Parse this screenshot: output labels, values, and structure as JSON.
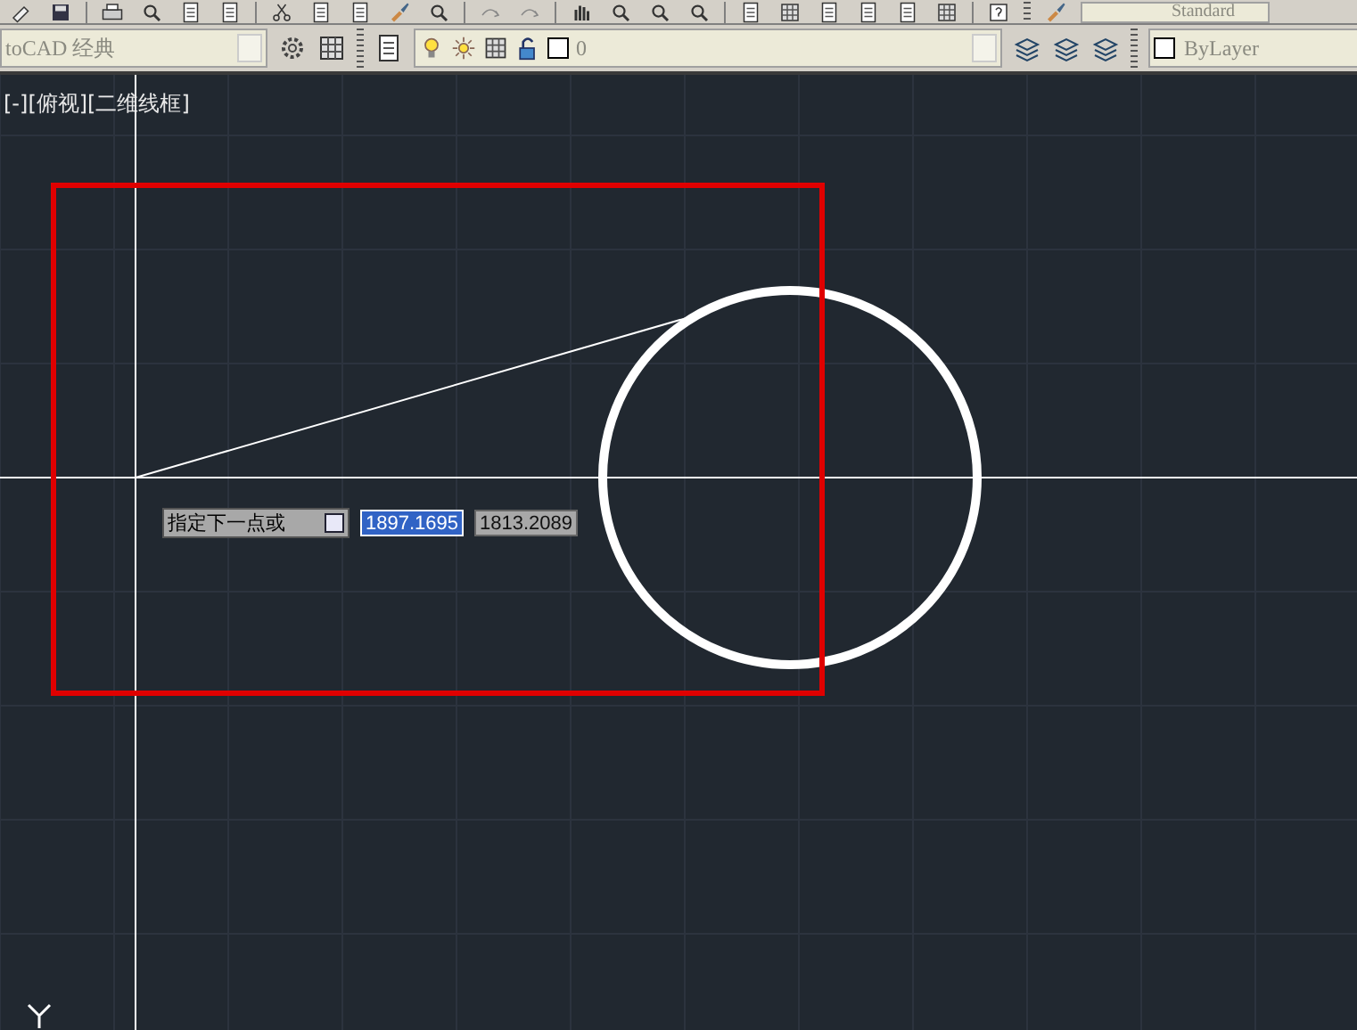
{
  "toolbar_top": {
    "text_style": "Standard"
  },
  "workspace": {
    "value": "toCAD 经典"
  },
  "layer_control": {
    "name": "0"
  },
  "color_control": {
    "value": "ByLayer"
  },
  "viewport": {
    "label": "[-][俯视][二维线框]"
  },
  "dynamic_input": {
    "prompt": "指定下一点或",
    "fields": [
      {
        "value": "1897.1695",
        "selected": true
      },
      {
        "value": "1813.2089",
        "selected": false
      }
    ]
  }
}
